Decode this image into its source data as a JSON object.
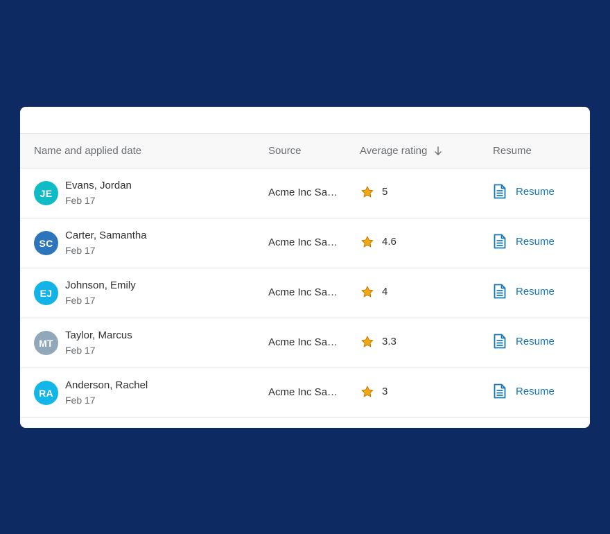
{
  "table": {
    "columns": {
      "name": "Name and applied date",
      "source": "Source",
      "rating": "Average rating",
      "resume": "Resume"
    },
    "rows": [
      {
        "initials": "JE",
        "avatar_color": "#0fbcc6",
        "name": "Evans, Jordan",
        "date": "Feb 17",
        "source": "Acme Inc Sa…",
        "rating": "5",
        "resume_label": "Resume"
      },
      {
        "initials": "SC",
        "avatar_color": "#2c75bb",
        "name": "Carter, Samantha",
        "date": "Feb 17",
        "source": "Acme Inc Sa…",
        "rating": "4.6",
        "resume_label": "Resume"
      },
      {
        "initials": "EJ",
        "avatar_color": "#12b4e8",
        "name": "Johnson, Emily",
        "date": "Feb 17",
        "source": "Acme Inc Sa…",
        "rating": "4",
        "resume_label": "Resume"
      },
      {
        "initials": "MT",
        "avatar_color": "#90a8ba",
        "name": "Taylor, Marcus",
        "date": "Feb 17",
        "source": "Acme Inc Sa…",
        "rating": "3.3",
        "resume_label": "Resume"
      },
      {
        "initials": "RA",
        "avatar_color": "#13b6e8",
        "name": "Anderson, Rachel",
        "date": "Feb 17",
        "source": "Acme Inc Sa…",
        "rating": "3",
        "resume_label": "Resume"
      }
    ],
    "partial_row": {
      "avatar_color": "#1f6fbf"
    }
  },
  "colors": {
    "background": "#0e2a63",
    "link": "#1477b8",
    "star_fill": "#f3a712",
    "star_stroke": "#c17a00"
  },
  "icons": {
    "sort": "arrow-down-icon",
    "rating": "star-icon",
    "resume": "document-icon"
  }
}
